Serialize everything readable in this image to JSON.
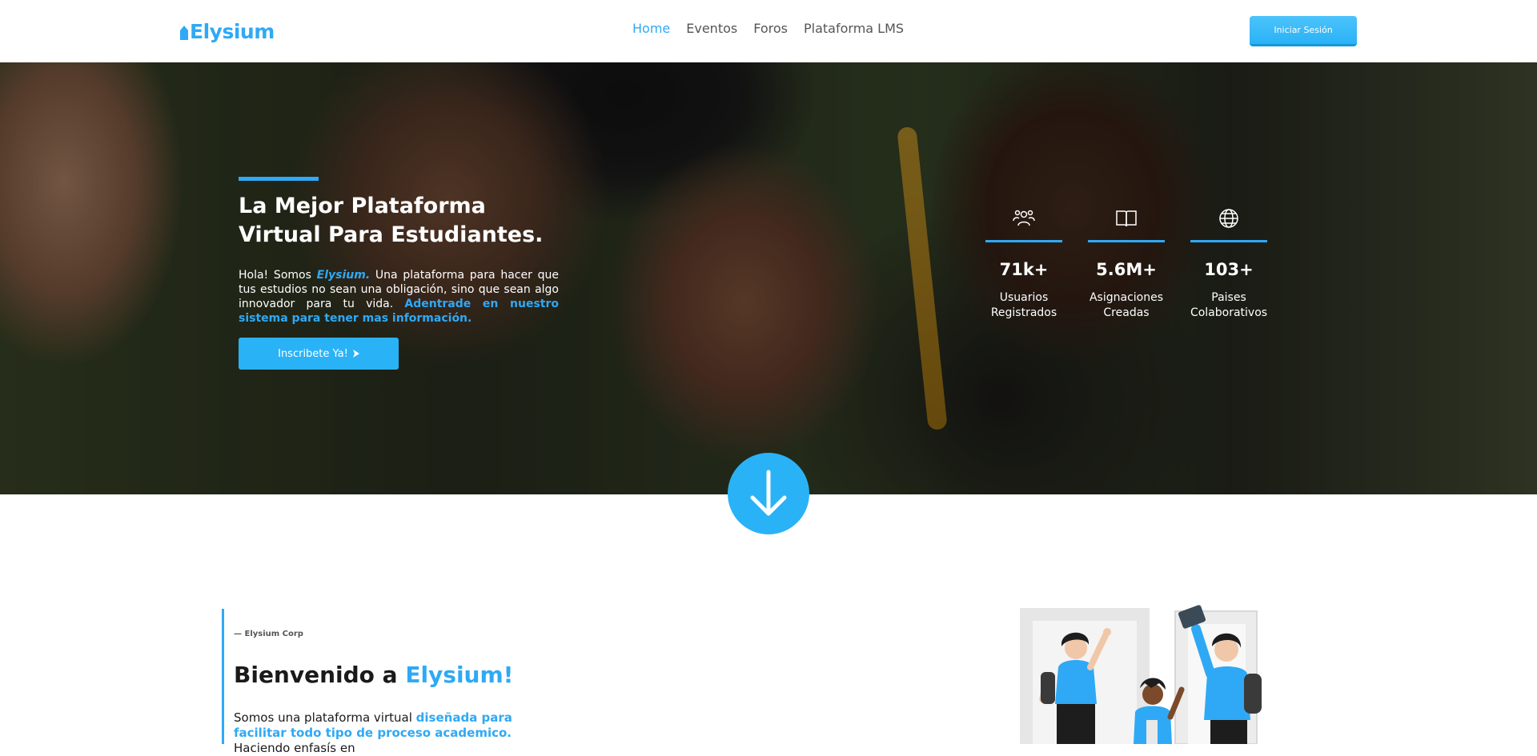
{
  "nav": {
    "logo_text": "Elysium",
    "links": [
      {
        "label": "Home",
        "active": true
      },
      {
        "label": "Eventos",
        "active": false
      },
      {
        "label": "Foros",
        "active": false
      },
      {
        "label": "Plataforma LMS",
        "active": false
      }
    ],
    "login_label": "Iniciar Sesión"
  },
  "hero": {
    "title": "La Mejor Plataforma Virtual Para Estudiantes.",
    "text_intro": "Hola! Somos ",
    "text_brand": "Elysium.",
    "text_body": " Una plataforma para hacer que tus estudios no sean una obligación, sino que sean algo innovador para tu vida. ",
    "text_link": "Adentrade en nuestro sistema para tener mas información.",
    "cta_label": "Inscribete Ya!",
    "cta_icon": "triangle-right-icon"
  },
  "stats": [
    {
      "icon": "users-icon",
      "value": "71k+",
      "label": "Usuarios Registrados"
    },
    {
      "icon": "book-icon",
      "value": "5.6M+",
      "label": "Asignaciones Creadas"
    },
    {
      "icon": "globe-icon",
      "value": "103+",
      "label": "Paises Colaborativos"
    }
  ],
  "scroll_icon": "arrow-down-icon",
  "about": {
    "kicker": "— Elysium Corp",
    "title_prefix": "Bienvenido a ",
    "title_highlight": "Elysium!",
    "text_start": "Somos una plataforma virtual ",
    "text_highlight": "diseñada para facilitar todo tipo de proceso academico.",
    "text_end": " Haciendo enfasís en"
  },
  "colors": {
    "accent": "#2fa9f5",
    "button": "#2ab2f7",
    "text_dark": "#1a1a1a"
  }
}
